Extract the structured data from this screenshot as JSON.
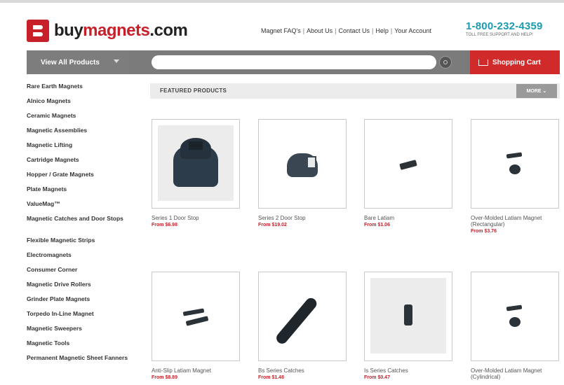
{
  "header": {
    "logo": {
      "part1": "buy",
      "part2": "magnets",
      "part3": ".com"
    },
    "links": [
      "Magnet FAQ's",
      "About Us",
      "Contact Us",
      "Help",
      "Your Account"
    ],
    "phone": "1-800-232-4359",
    "phone_sub": "TOLL FREE SUPPORT AND HELP!"
  },
  "navbar": {
    "view_all": "View All Products",
    "search_placeholder": "",
    "cart_label": "Shopping Cart"
  },
  "sidebar": {
    "categories": [
      "Rare Earth Magnets",
      "Alnico Magnets",
      "Ceramic Magnets",
      "Magnetic Assemblies",
      "Magnetic Lifting",
      "Cartridge Magnets",
      "Hopper / Grate Magnets",
      "Plate Magnets",
      "ValueMag™",
      "Magnetic Catches and Door Stops",
      "Flexible Magnetic Strips",
      "Electromagnets",
      "Consumer Corner",
      "Magnetic Drive Rollers",
      "Grinder Plate Magnets",
      "Torpedo In-Line Magnet",
      "Magnetic Sweepers",
      "Magnetic Tools",
      "Permanent Magnetic Sheet Fanners"
    ]
  },
  "featured": {
    "title": "FEATURED PRODUCTS",
    "more_label": "MORE",
    "products": [
      {
        "name": "Series 1 Door Stop",
        "price": "From $6.98"
      },
      {
        "name": "Series 2 Door Stop",
        "price": "From $19.02"
      },
      {
        "name": "Bare Latiam",
        "price": "From $1.06"
      },
      {
        "name": "Over-Molded Latiam Magnet (Rectangular)",
        "price": "From $3.76"
      },
      {
        "name": "Anti-Slip Latiam Magnet",
        "price": "From $8.89"
      },
      {
        "name": "Bs Series Catches",
        "price": "From $1.48"
      },
      {
        "name": "Is Series Catches",
        "price": "From $0.47"
      },
      {
        "name": "Over-Molded Latiam Magnet (Cylindrical)",
        "price": ""
      }
    ]
  }
}
